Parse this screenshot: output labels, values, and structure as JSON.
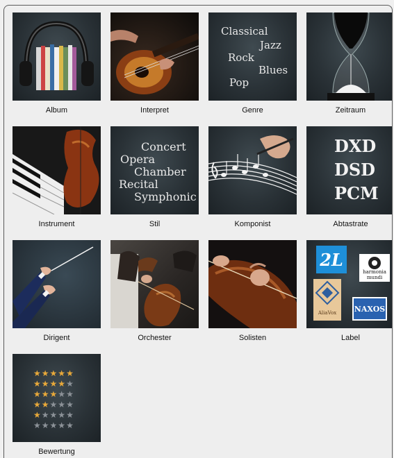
{
  "tiles": [
    {
      "label": "Album",
      "icon": "album-headphones-icon"
    },
    {
      "label": "Interpret",
      "icon": "guitar-player-icon"
    },
    {
      "label": "Genre",
      "icon": "genre-words-icon",
      "words": [
        "Classical",
        "Jazz",
        "Rock",
        "Blues",
        "Pop"
      ]
    },
    {
      "label": "Zeitraum",
      "icon": "hourglass-icon"
    },
    {
      "label": "Instrument",
      "icon": "piano-violin-icon"
    },
    {
      "label": "Stil",
      "icon": "style-words-icon",
      "words": [
        "Concert",
        "Opera",
        "Chamber",
        "Recital",
        "Symphonic"
      ]
    },
    {
      "label": "Komponist",
      "icon": "composer-sheet-music-icon"
    },
    {
      "label": "Abtastrate",
      "icon": "sample-rate-icon",
      "words": [
        "DXD",
        "DSD",
        "PCM"
      ]
    },
    {
      "label": "Dirigent",
      "icon": "conductor-icon"
    },
    {
      "label": "Orchester",
      "icon": "orchestra-strings-icon"
    },
    {
      "label": "Solisten",
      "icon": "soloist-violin-icon"
    },
    {
      "label": "Label",
      "icon": "record-labels-icon",
      "words": [
        "2L",
        "harmonia mundi",
        "AliaVox",
        "NAXOS"
      ]
    },
    {
      "label": "Bewertung",
      "icon": "rating-stars-icon",
      "rating_levels": [
        5,
        4,
        3,
        2,
        1,
        0
      ]
    }
  ],
  "colors": {
    "tile_bg": "#2a3237",
    "star_gold": "#e8a93a",
    "star_grey": "#8c9298",
    "page_bg": "#eeeeee"
  }
}
